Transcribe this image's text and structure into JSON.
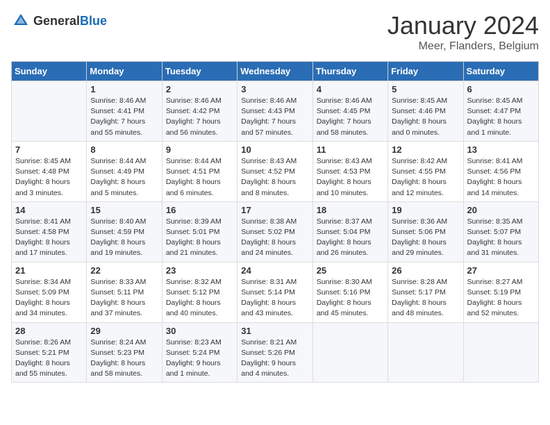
{
  "logo": {
    "general": "General",
    "blue": "Blue"
  },
  "title": "January 2024",
  "location": "Meer, Flanders, Belgium",
  "weekdays": [
    "Sunday",
    "Monday",
    "Tuesday",
    "Wednesday",
    "Thursday",
    "Friday",
    "Saturday"
  ],
  "weeks": [
    [
      {
        "day": "",
        "sunrise": "",
        "sunset": "",
        "daylight": ""
      },
      {
        "day": "1",
        "sunrise": "Sunrise: 8:46 AM",
        "sunset": "Sunset: 4:41 PM",
        "daylight": "Daylight: 7 hours and 55 minutes."
      },
      {
        "day": "2",
        "sunrise": "Sunrise: 8:46 AM",
        "sunset": "Sunset: 4:42 PM",
        "daylight": "Daylight: 7 hours and 56 minutes."
      },
      {
        "day": "3",
        "sunrise": "Sunrise: 8:46 AM",
        "sunset": "Sunset: 4:43 PM",
        "daylight": "Daylight: 7 hours and 57 minutes."
      },
      {
        "day": "4",
        "sunrise": "Sunrise: 8:46 AM",
        "sunset": "Sunset: 4:45 PM",
        "daylight": "Daylight: 7 hours and 58 minutes."
      },
      {
        "day": "5",
        "sunrise": "Sunrise: 8:45 AM",
        "sunset": "Sunset: 4:46 PM",
        "daylight": "Daylight: 8 hours and 0 minutes."
      },
      {
        "day": "6",
        "sunrise": "Sunrise: 8:45 AM",
        "sunset": "Sunset: 4:47 PM",
        "daylight": "Daylight: 8 hours and 1 minute."
      }
    ],
    [
      {
        "day": "7",
        "sunrise": "Sunrise: 8:45 AM",
        "sunset": "Sunset: 4:48 PM",
        "daylight": "Daylight: 8 hours and 3 minutes."
      },
      {
        "day": "8",
        "sunrise": "Sunrise: 8:44 AM",
        "sunset": "Sunset: 4:49 PM",
        "daylight": "Daylight: 8 hours and 5 minutes."
      },
      {
        "day": "9",
        "sunrise": "Sunrise: 8:44 AM",
        "sunset": "Sunset: 4:51 PM",
        "daylight": "Daylight: 8 hours and 6 minutes."
      },
      {
        "day": "10",
        "sunrise": "Sunrise: 8:43 AM",
        "sunset": "Sunset: 4:52 PM",
        "daylight": "Daylight: 8 hours and 8 minutes."
      },
      {
        "day": "11",
        "sunrise": "Sunrise: 8:43 AM",
        "sunset": "Sunset: 4:53 PM",
        "daylight": "Daylight: 8 hours and 10 minutes."
      },
      {
        "day": "12",
        "sunrise": "Sunrise: 8:42 AM",
        "sunset": "Sunset: 4:55 PM",
        "daylight": "Daylight: 8 hours and 12 minutes."
      },
      {
        "day": "13",
        "sunrise": "Sunrise: 8:41 AM",
        "sunset": "Sunset: 4:56 PM",
        "daylight": "Daylight: 8 hours and 14 minutes."
      }
    ],
    [
      {
        "day": "14",
        "sunrise": "Sunrise: 8:41 AM",
        "sunset": "Sunset: 4:58 PM",
        "daylight": "Daylight: 8 hours and 17 minutes."
      },
      {
        "day": "15",
        "sunrise": "Sunrise: 8:40 AM",
        "sunset": "Sunset: 4:59 PM",
        "daylight": "Daylight: 8 hours and 19 minutes."
      },
      {
        "day": "16",
        "sunrise": "Sunrise: 8:39 AM",
        "sunset": "Sunset: 5:01 PM",
        "daylight": "Daylight: 8 hours and 21 minutes."
      },
      {
        "day": "17",
        "sunrise": "Sunrise: 8:38 AM",
        "sunset": "Sunset: 5:02 PM",
        "daylight": "Daylight: 8 hours and 24 minutes."
      },
      {
        "day": "18",
        "sunrise": "Sunrise: 8:37 AM",
        "sunset": "Sunset: 5:04 PM",
        "daylight": "Daylight: 8 hours and 26 minutes."
      },
      {
        "day": "19",
        "sunrise": "Sunrise: 8:36 AM",
        "sunset": "Sunset: 5:06 PM",
        "daylight": "Daylight: 8 hours and 29 minutes."
      },
      {
        "day": "20",
        "sunrise": "Sunrise: 8:35 AM",
        "sunset": "Sunset: 5:07 PM",
        "daylight": "Daylight: 8 hours and 31 minutes."
      }
    ],
    [
      {
        "day": "21",
        "sunrise": "Sunrise: 8:34 AM",
        "sunset": "Sunset: 5:09 PM",
        "daylight": "Daylight: 8 hours and 34 minutes."
      },
      {
        "day": "22",
        "sunrise": "Sunrise: 8:33 AM",
        "sunset": "Sunset: 5:11 PM",
        "daylight": "Daylight: 8 hours and 37 minutes."
      },
      {
        "day": "23",
        "sunrise": "Sunrise: 8:32 AM",
        "sunset": "Sunset: 5:12 PM",
        "daylight": "Daylight: 8 hours and 40 minutes."
      },
      {
        "day": "24",
        "sunrise": "Sunrise: 8:31 AM",
        "sunset": "Sunset: 5:14 PM",
        "daylight": "Daylight: 8 hours and 43 minutes."
      },
      {
        "day": "25",
        "sunrise": "Sunrise: 8:30 AM",
        "sunset": "Sunset: 5:16 PM",
        "daylight": "Daylight: 8 hours and 45 minutes."
      },
      {
        "day": "26",
        "sunrise": "Sunrise: 8:28 AM",
        "sunset": "Sunset: 5:17 PM",
        "daylight": "Daylight: 8 hours and 48 minutes."
      },
      {
        "day": "27",
        "sunrise": "Sunrise: 8:27 AM",
        "sunset": "Sunset: 5:19 PM",
        "daylight": "Daylight: 8 hours and 52 minutes."
      }
    ],
    [
      {
        "day": "28",
        "sunrise": "Sunrise: 8:26 AM",
        "sunset": "Sunset: 5:21 PM",
        "daylight": "Daylight: 8 hours and 55 minutes."
      },
      {
        "day": "29",
        "sunrise": "Sunrise: 8:24 AM",
        "sunset": "Sunset: 5:23 PM",
        "daylight": "Daylight: 8 hours and 58 minutes."
      },
      {
        "day": "30",
        "sunrise": "Sunrise: 8:23 AM",
        "sunset": "Sunset: 5:24 PM",
        "daylight": "Daylight: 9 hours and 1 minute."
      },
      {
        "day": "31",
        "sunrise": "Sunrise: 8:21 AM",
        "sunset": "Sunset: 5:26 PM",
        "daylight": "Daylight: 9 hours and 4 minutes."
      },
      {
        "day": "",
        "sunrise": "",
        "sunset": "",
        "daylight": ""
      },
      {
        "day": "",
        "sunrise": "",
        "sunset": "",
        "daylight": ""
      },
      {
        "day": "",
        "sunrise": "",
        "sunset": "",
        "daylight": ""
      }
    ]
  ]
}
